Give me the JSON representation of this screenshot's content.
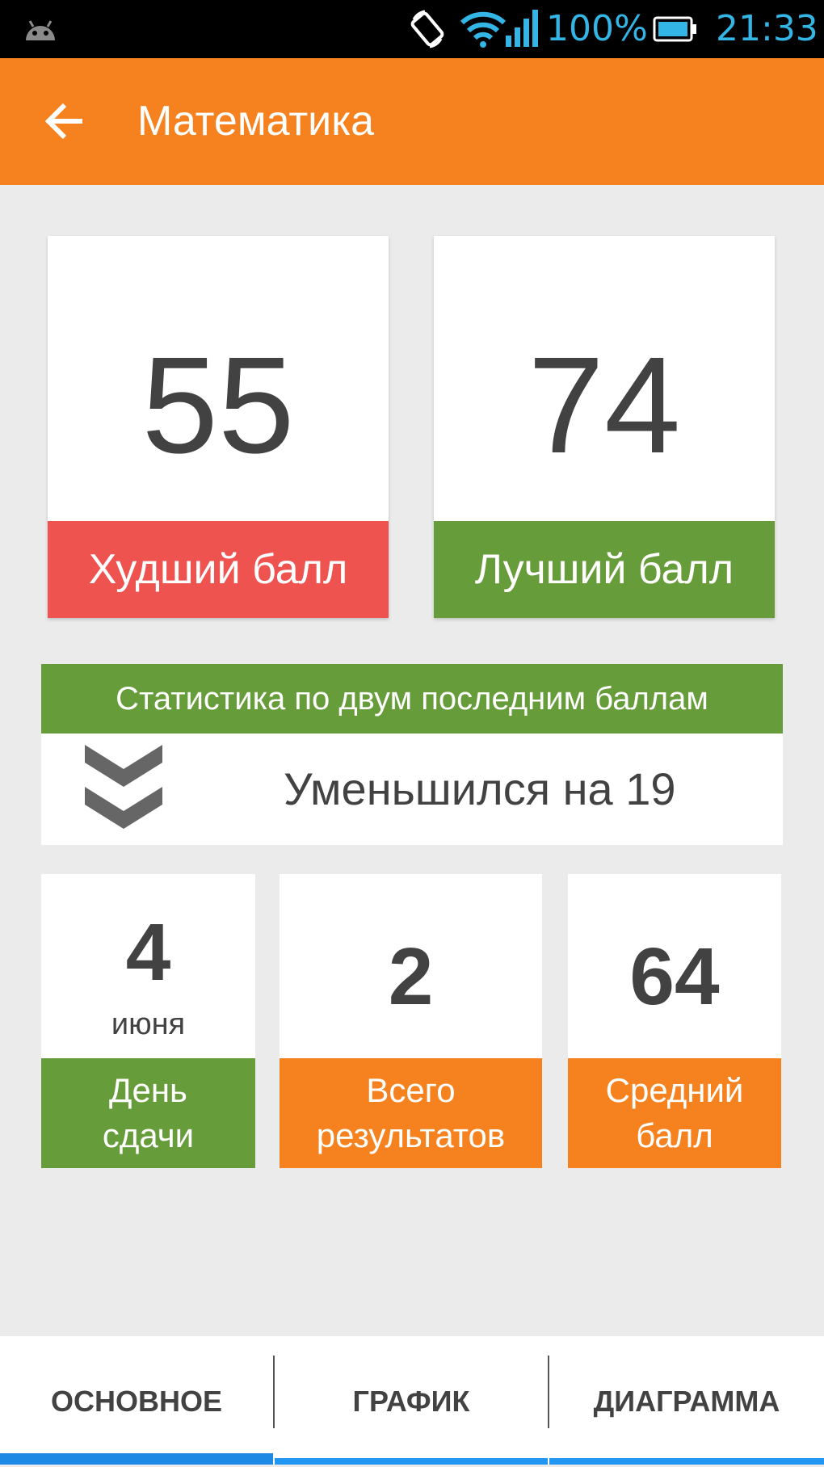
{
  "status_bar": {
    "battery": "100%",
    "time": "21:33"
  },
  "app_bar": {
    "title": "Математика"
  },
  "score_cards": [
    {
      "value": "55",
      "label": "Худший балл",
      "color": "#ef5350"
    },
    {
      "value": "74",
      "label": "Лучший балл",
      "color": "#679c3a"
    }
  ],
  "stats": {
    "header": "Статистика по двум последним баллам",
    "text": "Уменьшился на 19"
  },
  "info_cards": [
    {
      "value": "4",
      "sub": "июня",
      "label": "День\nсдачи",
      "color": "#679c3a"
    },
    {
      "value": "2",
      "sub": "",
      "label": "Всего\nрезультатов",
      "color": "#f5821f"
    },
    {
      "value": "64",
      "sub": "",
      "label": "Средний\nбалл",
      "color": "#f5821f"
    }
  ],
  "tabs": [
    {
      "label": "ОСНОВНОЕ",
      "active": true
    },
    {
      "label": "ГРАФИК",
      "active": false
    },
    {
      "label": "ДИАГРАММА",
      "active": false
    }
  ],
  "colors": {
    "accent": "#f5821f",
    "green": "#679c3a",
    "red": "#ef5350",
    "tab_indicator": "#1e88e5"
  }
}
